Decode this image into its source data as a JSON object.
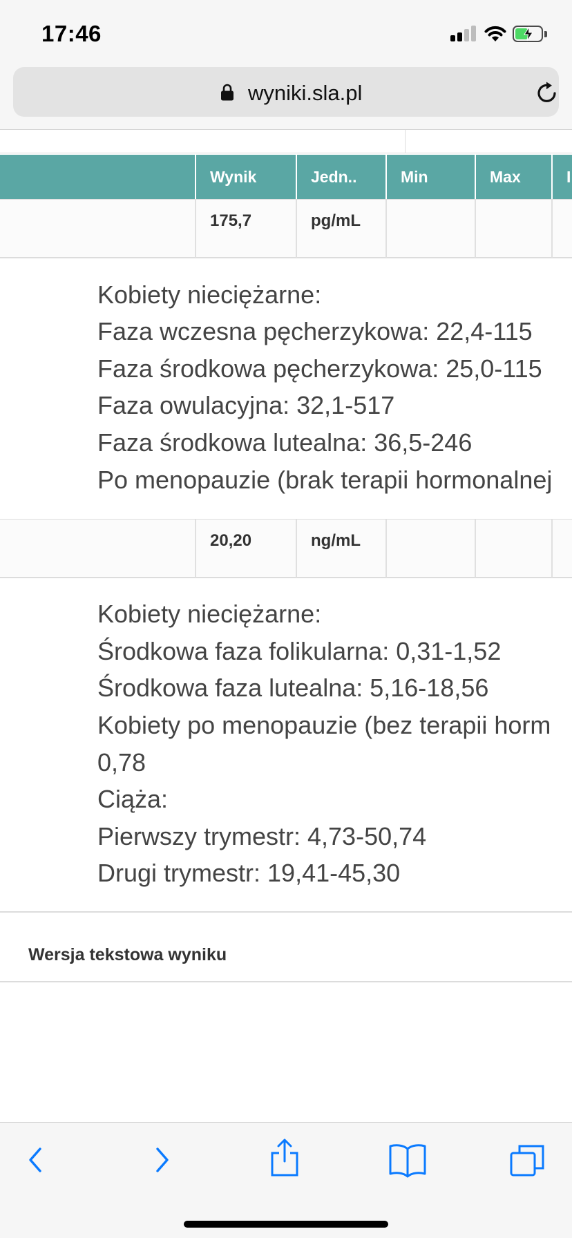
{
  "status_bar": {
    "time": "17:46"
  },
  "browser": {
    "url": "wyniki.sla.pl",
    "accent_color": "#0a7aff"
  },
  "table": {
    "header_color": "#5aa7a4",
    "columns": [
      "Wynik",
      "Jedn..",
      "Min",
      "Max",
      "I"
    ],
    "rows": [
      {
        "result": "175,7",
        "unit": "pg/mL",
        "min": "",
        "max": "",
        "reference_lines": [
          "Kobiety nieciężarne:",
          "Faza wczesna pęcherzykowa: 22,4-115",
          "Faza środkowa pęcherzykowa: 25,0-115",
          "Faza owulacyjna: 32,1-517",
          "Faza środkowa lutealna: 36,5-246",
          "Po menopauzie (brak terapii hormonalnej"
        ]
      },
      {
        "result": "20,20",
        "unit": "ng/mL",
        "min": "",
        "max": "",
        "reference_lines": [
          "Kobiety nieciężarne:",
          "Środkowa faza folikularna: 0,31-1,52",
          "Środkowa faza lutealna: 5,16-18,56",
          "Kobiety po menopauzie (bez terapii horm",
          "0,78",
          "Ciąża:",
          "Pierwszy trymestr: 4,73-50,74",
          "Drugi trymestr: 19,41-45,30"
        ]
      }
    ]
  },
  "footer": {
    "text_version_label": "Wersja tekstowa wyniku"
  },
  "toolbar": {
    "icons": [
      "back-icon",
      "forward-icon",
      "share-icon",
      "bookmarks-icon",
      "tabs-icon"
    ]
  }
}
